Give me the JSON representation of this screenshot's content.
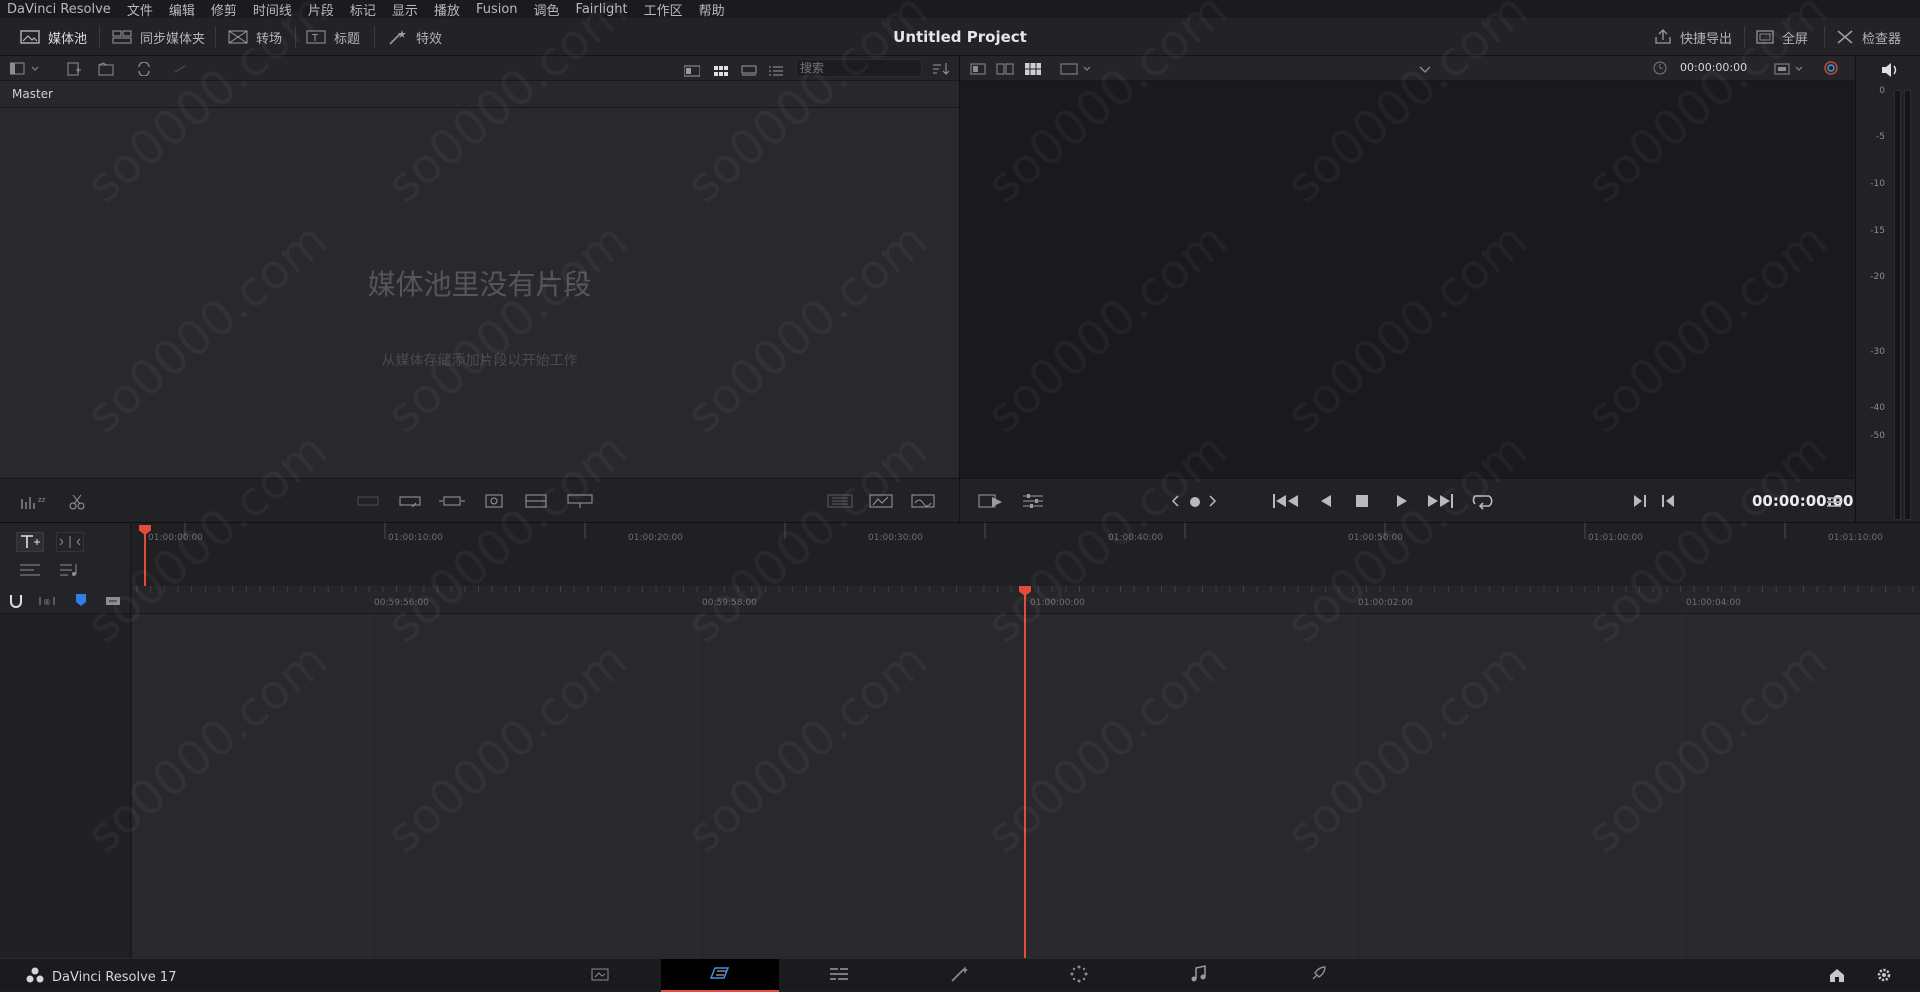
{
  "menu": [
    "DaVinci Resolve",
    "文件",
    "编辑",
    "修剪",
    "时间线",
    "片段",
    "标记",
    "显示",
    "播放",
    "Fusion",
    "调色",
    "Fairlight",
    "工作区",
    "帮助"
  ],
  "toolbar": {
    "media_pool": "媒体池",
    "sync_bin": "同步媒体夹",
    "transitions": "转场",
    "titles": "标题",
    "effects": "特效",
    "quick_export": "快捷导出",
    "fullscreen": "全屏",
    "inspector": "检查器"
  },
  "project_title": "Untitled Project",
  "media_pool": {
    "search_placeholder": "搜索",
    "bin_name": "Master",
    "empty_title": "媒体池里没有片段",
    "empty_subtitle": "从媒体存储添加片段以开始工作"
  },
  "viewer": {
    "timecode_top": "00:00:00:00",
    "timecode_main": "00:00:00:00"
  },
  "audio_meter": {
    "labels": [
      "0",
      "-5",
      "-10",
      "-15",
      "-20",
      "-30",
      "-40",
      "-50"
    ]
  },
  "timeline": {
    "upper_ruler": [
      "01:00:00:00",
      "01:00:10:00",
      "01:00:20:00",
      "01:00:30:00",
      "01:00:40:00",
      "01:00:50:00",
      "01:01:00:00",
      "01:01:10:00"
    ],
    "lower_ruler": [
      "00:59:56:00",
      "00:59:58:00",
      "01:00:00:00",
      "01:00:02:00",
      "01:00:04:00"
    ]
  },
  "footer": {
    "app_name": "DaVinci Resolve 17"
  },
  "pages": [
    "media",
    "cut",
    "edit",
    "fusion",
    "color",
    "fairlight",
    "deliver"
  ],
  "colors": {
    "accent": "#e24c3c",
    "blue_flag": "#2f7fe6"
  }
}
